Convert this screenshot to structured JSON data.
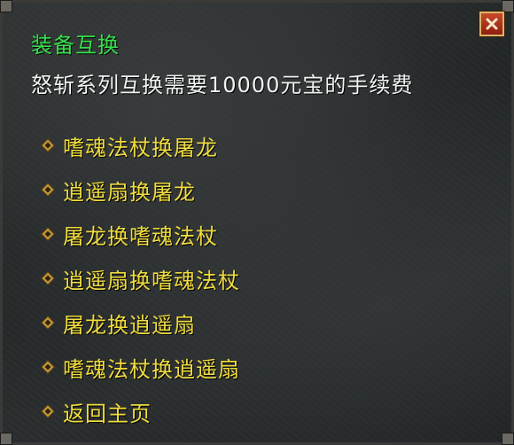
{
  "dialog": {
    "title": "装备互换",
    "description": "怒斩系列互换需要10000元宝的手续费",
    "close_icon": "close-icon",
    "menu": [
      {
        "label": "嗜魂法杖换屠龙",
        "icon": "diamond-bullet-icon"
      },
      {
        "label": "逍遥扇换屠龙",
        "icon": "diamond-bullet-icon"
      },
      {
        "label": "屠龙换嗜魂法杖",
        "icon": "diamond-bullet-icon"
      },
      {
        "label": "逍遥扇换嗜魂法杖",
        "icon": "diamond-bullet-icon"
      },
      {
        "label": "屠龙换逍遥扇",
        "icon": "diamond-bullet-icon"
      },
      {
        "label": "嗜魂法杖换逍遥扇",
        "icon": "diamond-bullet-icon"
      },
      {
        "label": "返回主页",
        "icon": "diamond-bullet-icon"
      }
    ]
  },
  "colors": {
    "title": "#35e04a",
    "description": "#f2f2f2",
    "menu_text": "#f0dc3e",
    "close_button": "#b5331c"
  }
}
